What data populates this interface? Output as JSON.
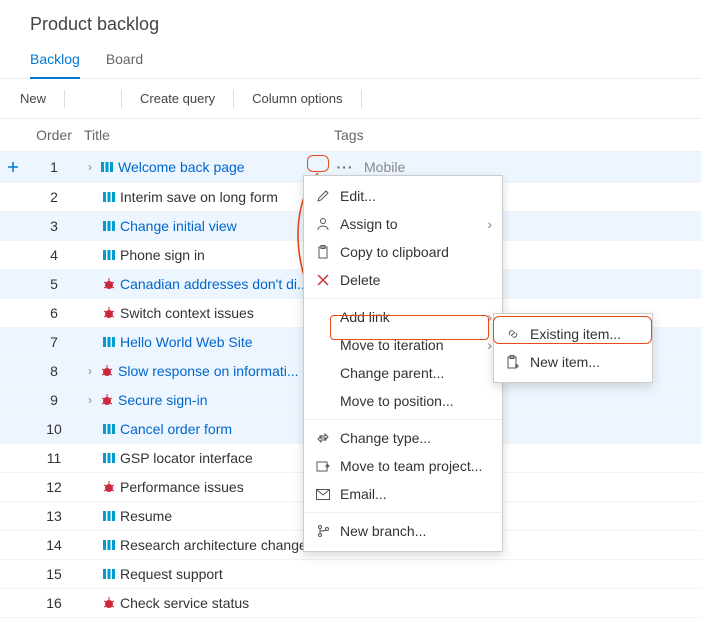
{
  "page_title": "Product backlog",
  "tabs": {
    "backlog": "Backlog",
    "board": "Board"
  },
  "toolbar": {
    "new": "New",
    "create_query": "Create query",
    "column_options": "Column options"
  },
  "columns": {
    "order": "Order",
    "title": "Title",
    "tags": "Tags"
  },
  "tags": {
    "row1": "Mobile"
  },
  "items": [
    {
      "order": "1",
      "title": "Welcome back page",
      "type": "pbi",
      "link": true,
      "expand": true
    },
    {
      "order": "2",
      "title": "Interim save on long form",
      "type": "pbi",
      "link": false
    },
    {
      "order": "3",
      "title": "Change initial view",
      "type": "pbi",
      "link": true
    },
    {
      "order": "4",
      "title": "Phone sign in",
      "type": "pbi",
      "link": false
    },
    {
      "order": "5",
      "title": "Canadian addresses don't di...",
      "type": "bug",
      "link": true
    },
    {
      "order": "6",
      "title": "Switch context issues",
      "type": "bug",
      "link": false
    },
    {
      "order": "7",
      "title": "Hello World Web Site",
      "type": "pbi",
      "link": true
    },
    {
      "order": "8",
      "title": "Slow response on informati...",
      "type": "bug",
      "link": true,
      "expand": true
    },
    {
      "order": "9",
      "title": "Secure sign-in",
      "type": "bug",
      "link": true,
      "expand": true
    },
    {
      "order": "10",
      "title": "Cancel order form",
      "type": "pbi",
      "link": true
    },
    {
      "order": "11",
      "title": "GSP locator interface",
      "type": "pbi",
      "link": false
    },
    {
      "order": "12",
      "title": "Performance issues",
      "type": "bug",
      "link": false
    },
    {
      "order": "13",
      "title": "Resume",
      "type": "pbi",
      "link": false
    },
    {
      "order": "14",
      "title": "Research architecture changes",
      "type": "pbi",
      "link": false
    },
    {
      "order": "15",
      "title": "Request support",
      "type": "pbi",
      "link": false
    },
    {
      "order": "16",
      "title": "Check service status",
      "type": "bug",
      "link": false
    }
  ],
  "menu": {
    "edit": "Edit...",
    "assign_to": "Assign to",
    "copy": "Copy to clipboard",
    "delete": "Delete",
    "add_link": "Add link",
    "move_iteration": "Move to iteration",
    "change_parent": "Change parent...",
    "move_position": "Move to position...",
    "change_type": "Change type...",
    "move_team_project": "Move to team project...",
    "email": "Email...",
    "new_branch": "New branch..."
  },
  "submenu": {
    "existing_item": "Existing item...",
    "new_item": "New item..."
  }
}
